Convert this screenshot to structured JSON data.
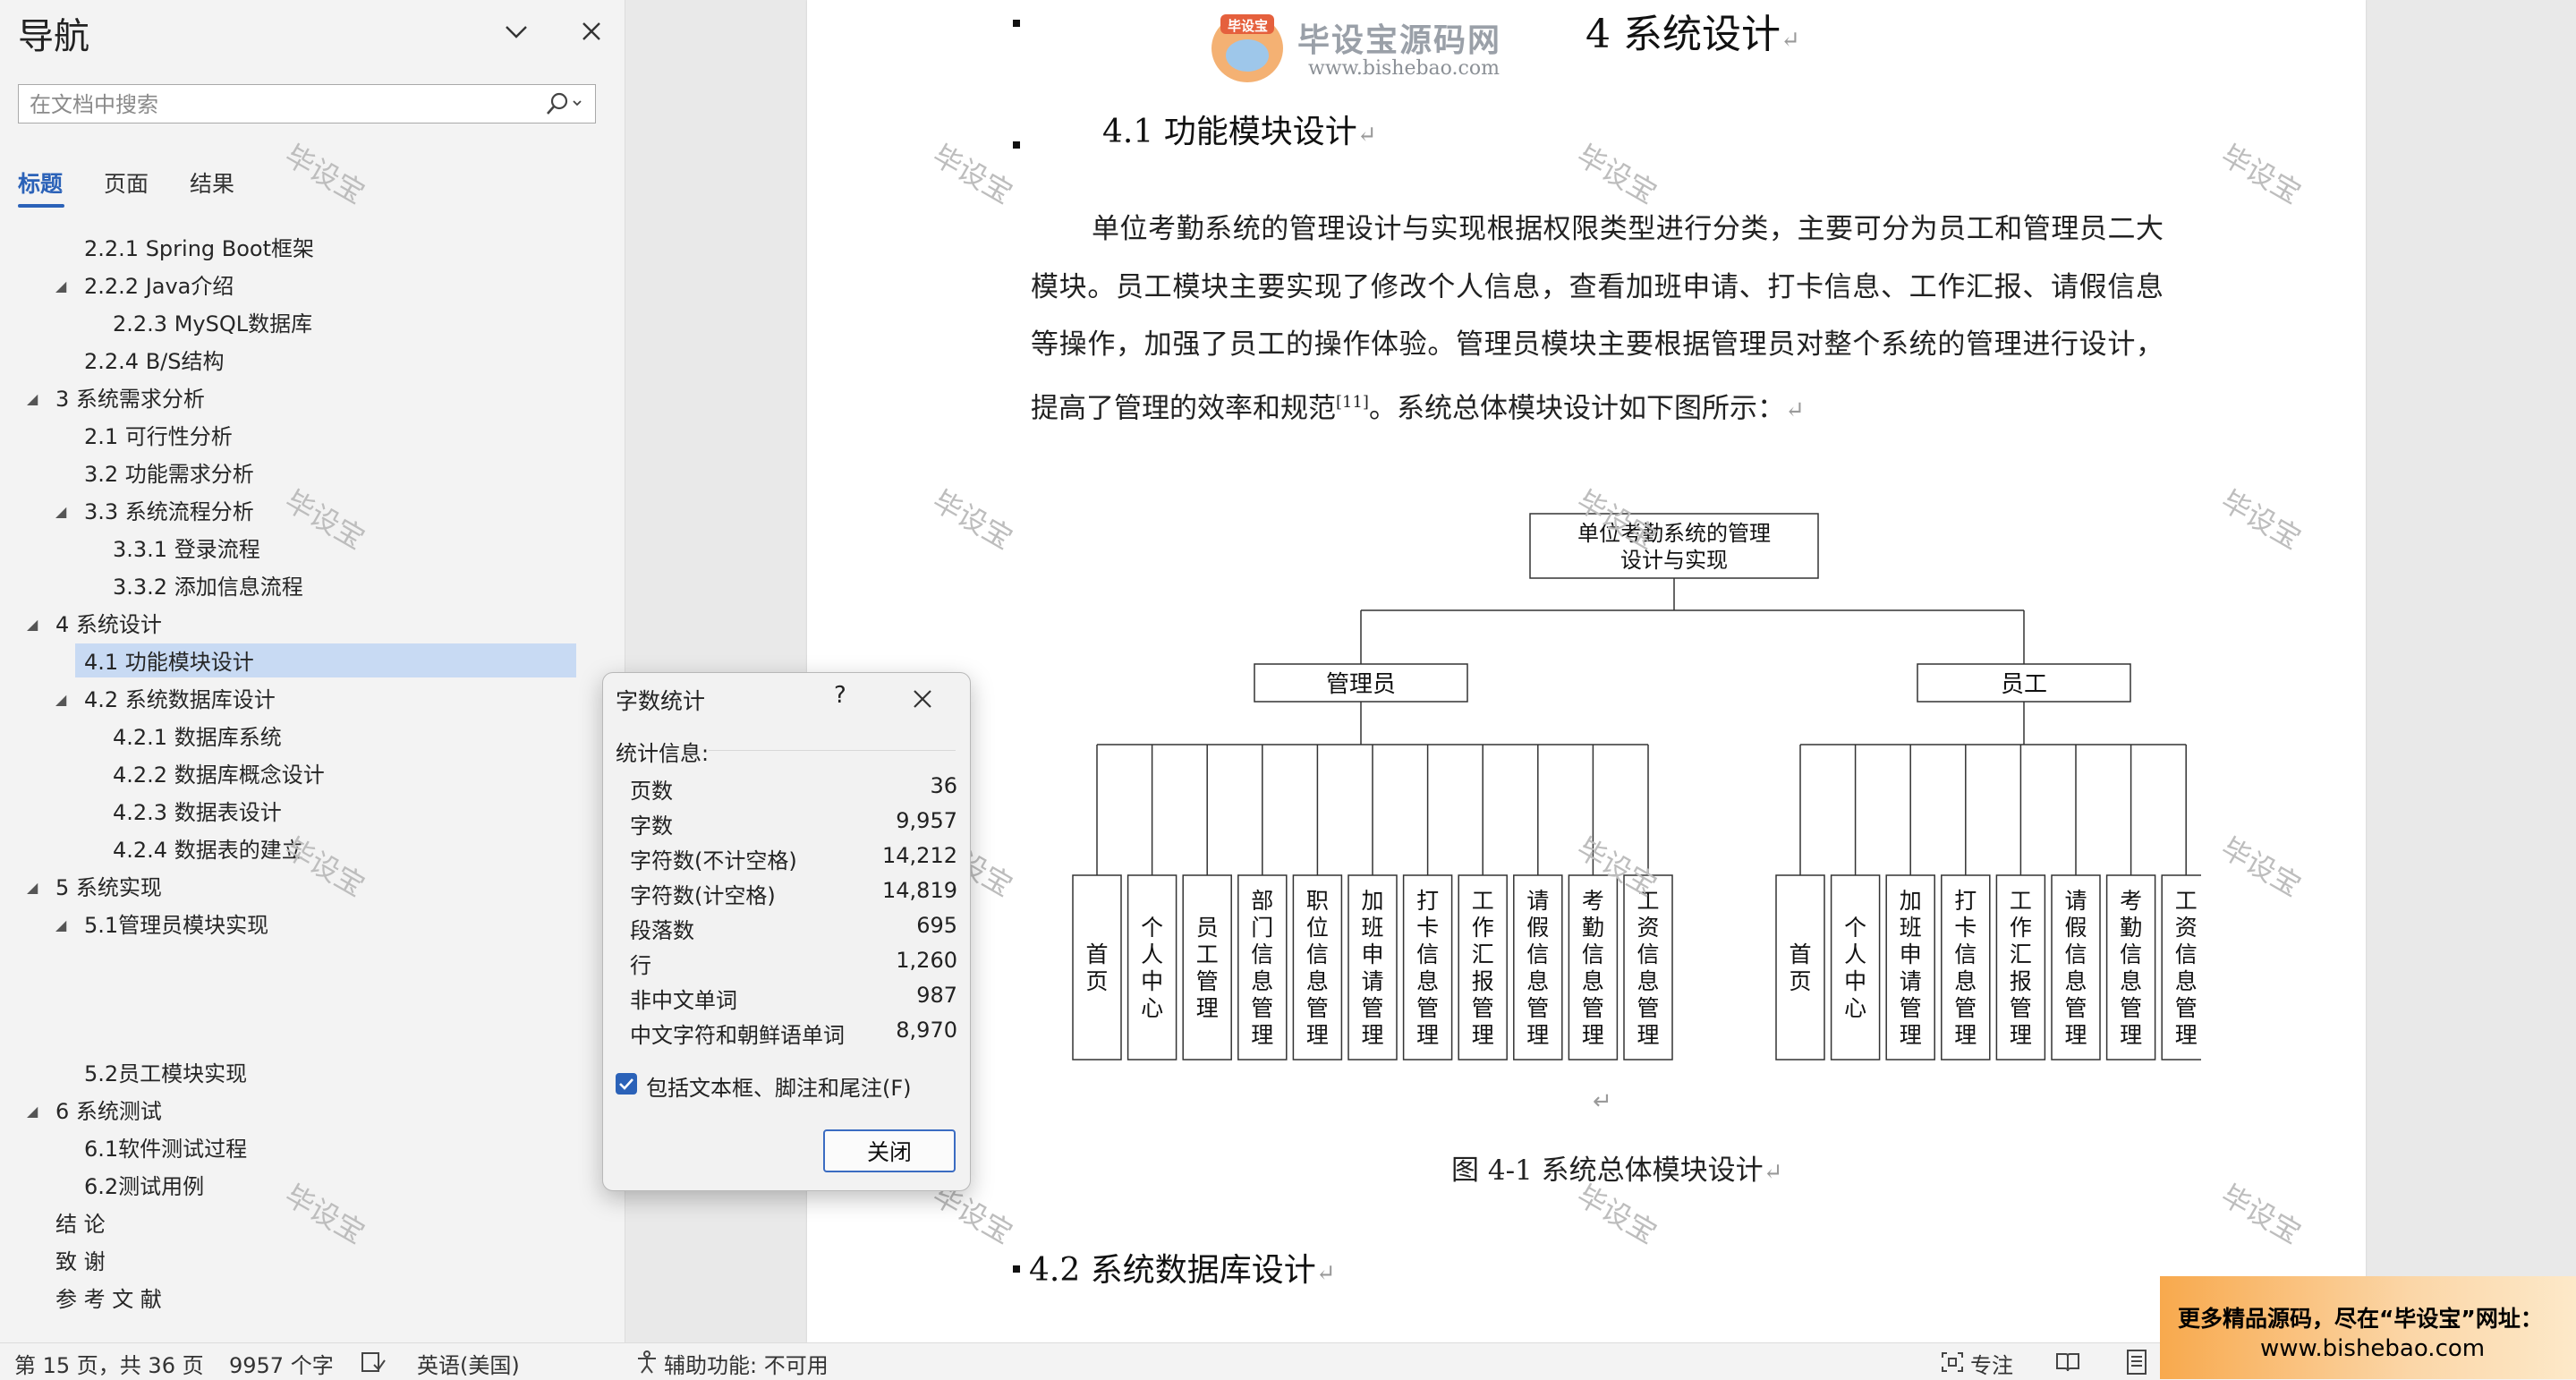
{
  "nav": {
    "title": "导航",
    "search_placeholder": "在文档中搜索",
    "tabs": [
      "标题",
      "页面",
      "结果"
    ],
    "tree": [
      "2.2.1 Spring Boot框架",
      "2.2.2 Java介绍",
      "2.2.3 MySQL数据库",
      "2.2.4 B/S结构",
      "3   系统需求分析",
      "2.1 可行性分析",
      "3.2 功能需求分析",
      "3.3 系统流程分析",
      "3.3.1 登录流程",
      "3.3.2 添加信息流程",
      "4   系统设计",
      "4.1 功能模块设计",
      "4.2 系统数据库设计",
      "4.2.1 数据库系统",
      "4.2.2 数据库概念设计",
      "4.2.3 数据表设计",
      "4.2.4 数据表的建立",
      "5   系统实现",
      "5.1管理员模块实现",
      "5.2员工模块实现",
      "6   系统测试",
      "6.1软件测试过程",
      "6.2测试用例",
      "结   论",
      "致   谢",
      "参 考 文 献"
    ]
  },
  "document": {
    "heading1": "4   系统设计",
    "heading2": "4.1  功能模块设计",
    "paragraph": "单位考勤系统的管理设计与实现根据权限类型进行分类，主要可分为员工和管理员二大模块。员工模块主要实现了修改个人信息，查看加班申请、打卡信息、工作汇报、请假信息等操作，加强了员工的操作体验。管理员模块主要根据管理员对整个系统的管理进行设计，提高了管理的效率和规范",
    "citation": "[11]",
    "paragraph_end": "。系统总体模块设计如下图所示：",
    "figure_caption": "图 4-1  系统总体模块设计",
    "heading3": "4.2  系统数据库设计",
    "para_mark": "↵",
    "watermark": "毕设宝",
    "logo_title": "毕设宝源码网",
    "logo_url": "www.bishebao.com",
    "logo_badge": "毕设宝"
  },
  "diagram": {
    "root": "单位考勤系统的管理设计与实现",
    "admin": {
      "label": "管理员",
      "children": [
        "首页",
        "个人中心",
        "员工管理",
        "部门信息管理",
        "职位信息管理",
        "加班申请管理",
        "打卡信息管理",
        "工作汇报管理",
        "请假信息管理",
        "考勤信息管理",
        "工资信息管理"
      ]
    },
    "employee": {
      "label": "员工",
      "children": [
        "首页",
        "个人中心",
        "加班申请管理",
        "打卡信息管理",
        "工作汇报管理",
        "请假信息管理",
        "考勤信息管理",
        "工资信息管理"
      ]
    }
  },
  "dialog": {
    "title": "字数统计",
    "help": "?",
    "section": "统计信息:",
    "stats": [
      {
        "label": "页数",
        "value": "36"
      },
      {
        "label": "字数",
        "value": "9,957"
      },
      {
        "label": "字符数(不计空格)",
        "value": "14,212"
      },
      {
        "label": "字符数(计空格)",
        "value": "14,819"
      },
      {
        "label": "段落数",
        "value": "695"
      },
      {
        "label": "行",
        "value": "1,260"
      },
      {
        "label": "非中文单词",
        "value": "987"
      },
      {
        "label": "中文字符和朝鲜语单词",
        "value": "8,970"
      }
    ],
    "checkbox_label": "包括文本框、脚注和尾注(F)",
    "checkbox_checked": true,
    "close_label": "关闭"
  },
  "status": {
    "page": "第 15 页，共 36 页",
    "words": "9957 个字",
    "language": "英语(美国)",
    "accessibility": "辅助功能: 不可用",
    "focus": "专注"
  },
  "ad": {
    "line1": "更多精品源码，尽在“毕设宝”网址：",
    "line2": "www.bishebao.com"
  },
  "colors": {
    "accent": "#2b62b8",
    "selection": "#c8daf3",
    "ad_orange": "#f8a94d"
  }
}
